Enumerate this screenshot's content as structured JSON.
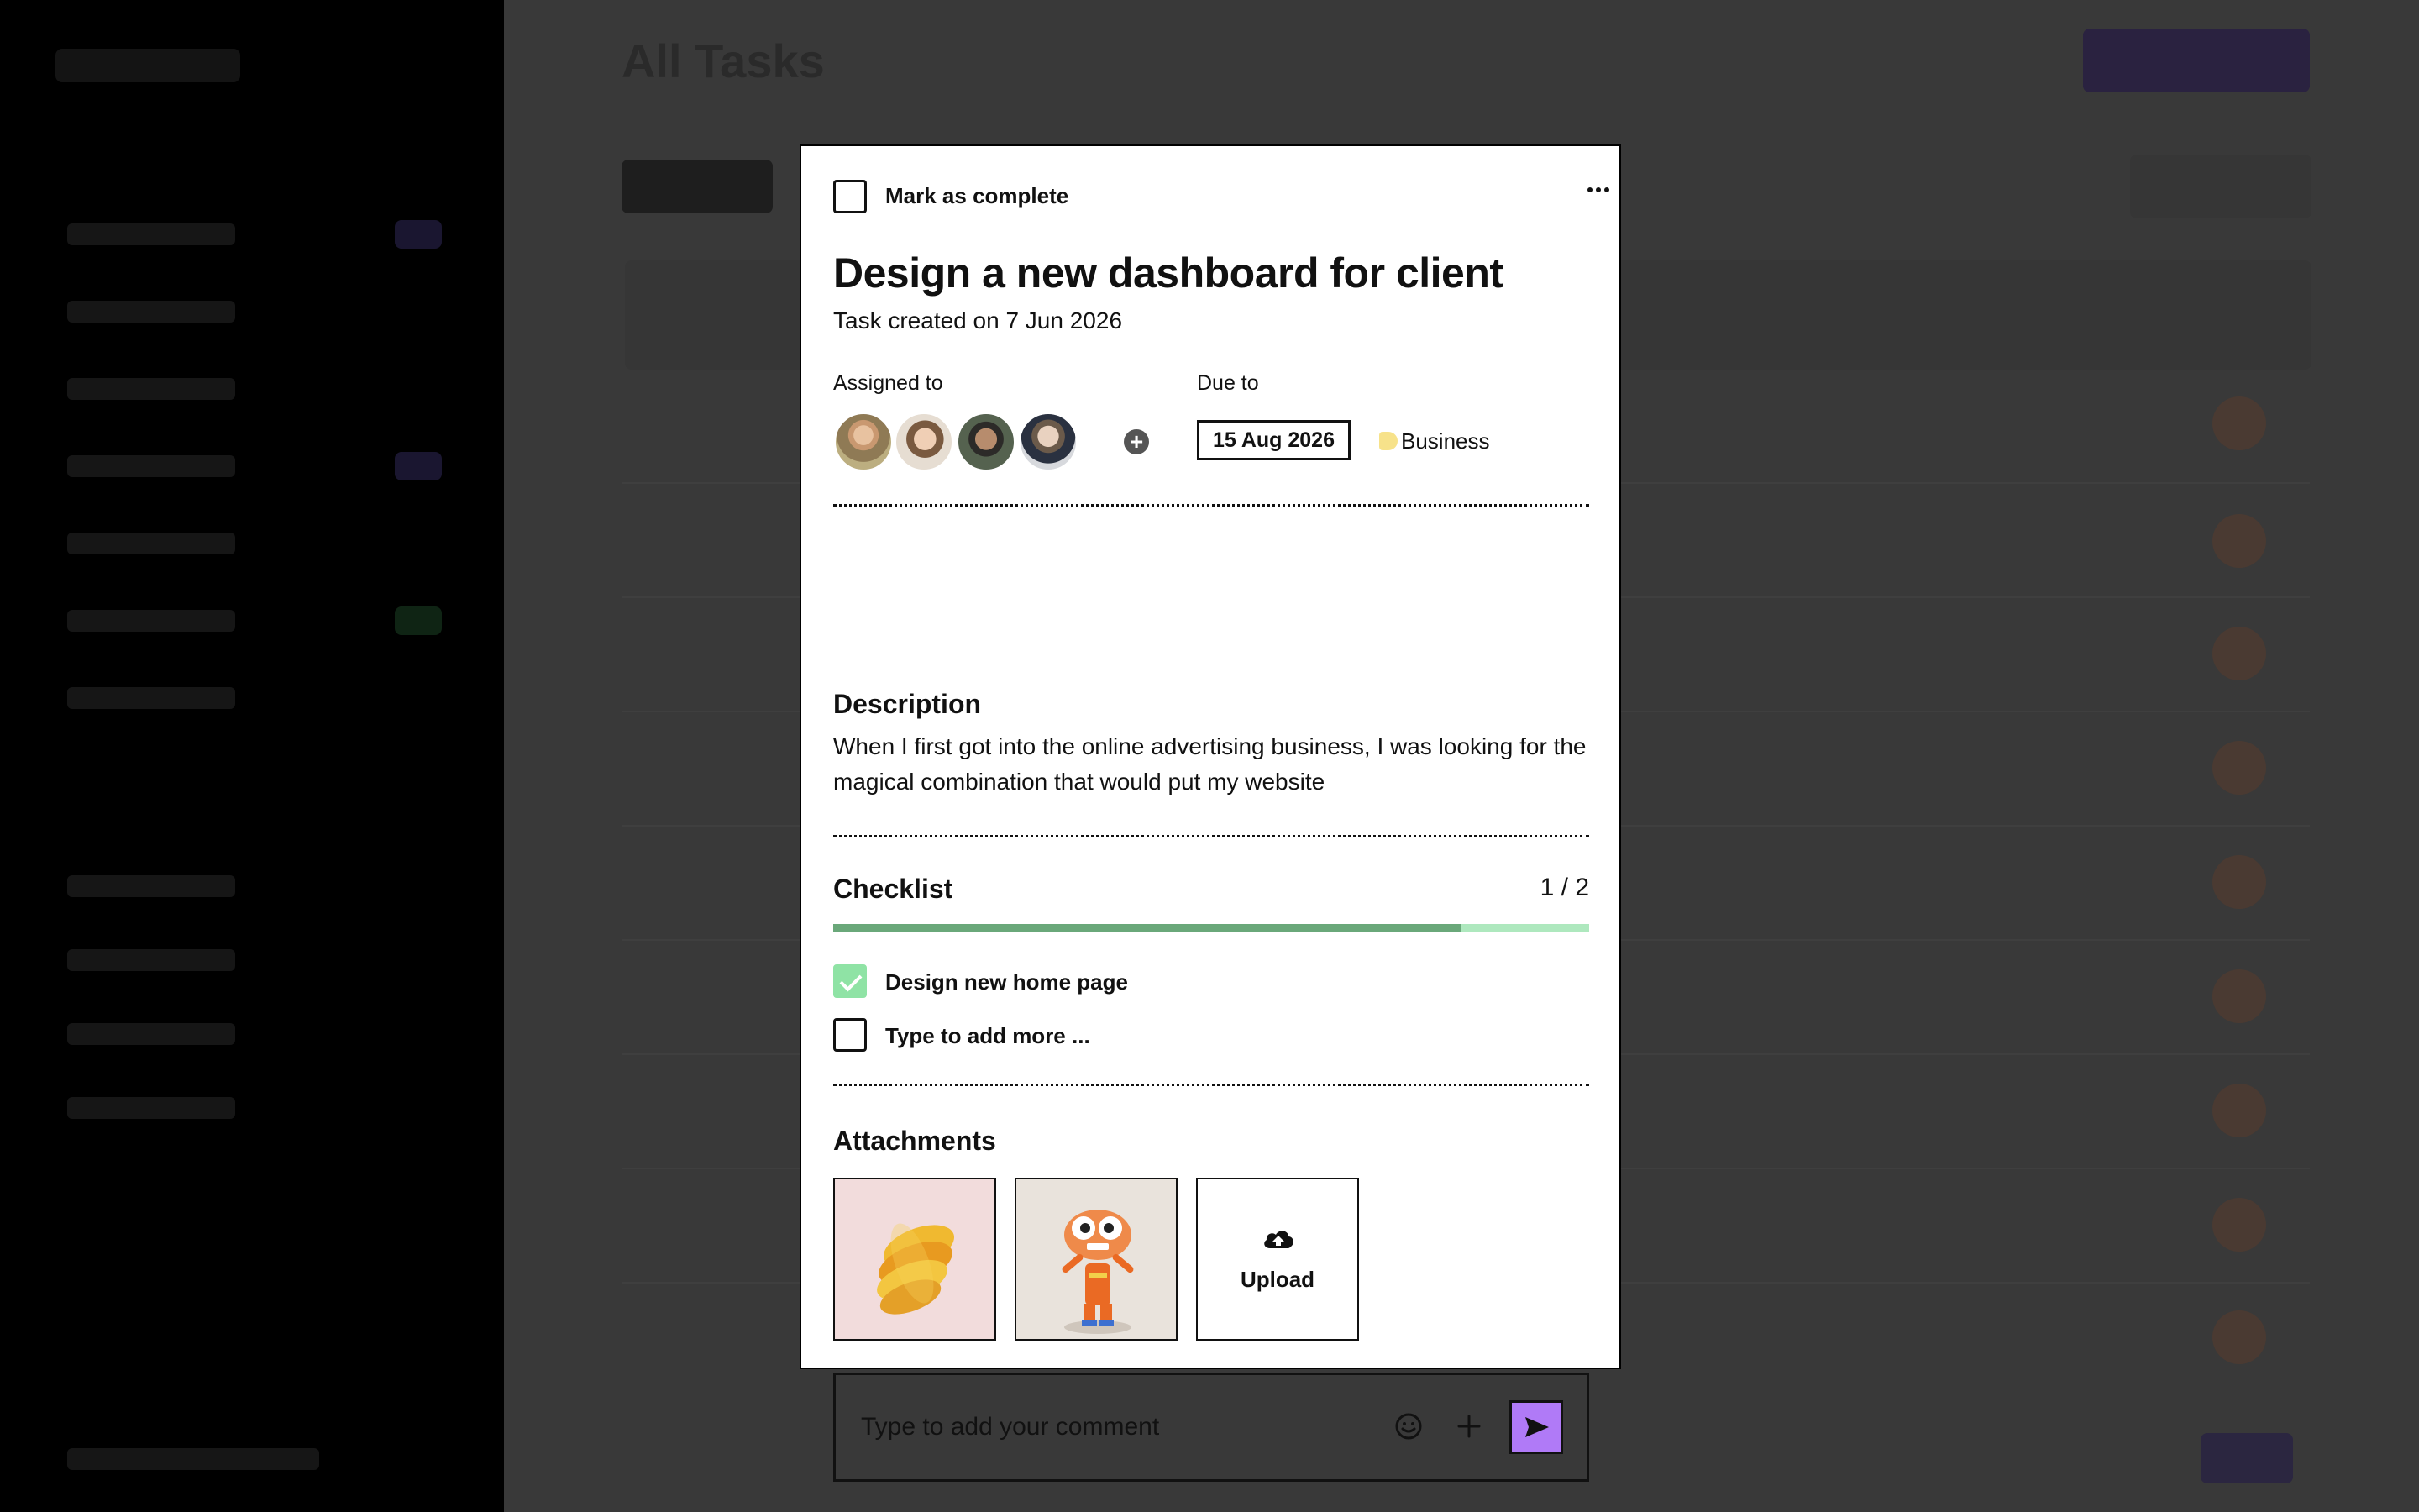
{
  "background": {
    "page_title": "All Tasks"
  },
  "modal": {
    "mark_complete_label": "Mark as complete",
    "more_icon": "more-horizontal-icon",
    "title": "Design a new dashboard for client",
    "subtitle": "Task created on 7 Jun 2026",
    "assigned_label": "Assigned to",
    "due_label": "Due to",
    "due_date": "15 Aug 2026",
    "tag": {
      "label": "Business",
      "color": "#f7e28a"
    },
    "description": {
      "heading": "Description",
      "text": "When I first got into the online advertising business, I was looking for the magical combination that would put my website"
    },
    "checklist": {
      "heading": "Checklist",
      "count": "1 / 2",
      "progress": 0.83,
      "items": [
        {
          "label": "Design new home page",
          "checked": true
        },
        {
          "label": "Type to add more ...",
          "checked": false
        }
      ]
    },
    "attachments": {
      "heading": "Attachments",
      "upload_label": "Upload"
    },
    "comment": {
      "placeholder": "Type to add your comment"
    },
    "colors": {
      "accent": "#b07af7",
      "checked": "#8fe3a5",
      "progress_fill": "#6aa87a",
      "progress_track": "#aee8be"
    }
  }
}
